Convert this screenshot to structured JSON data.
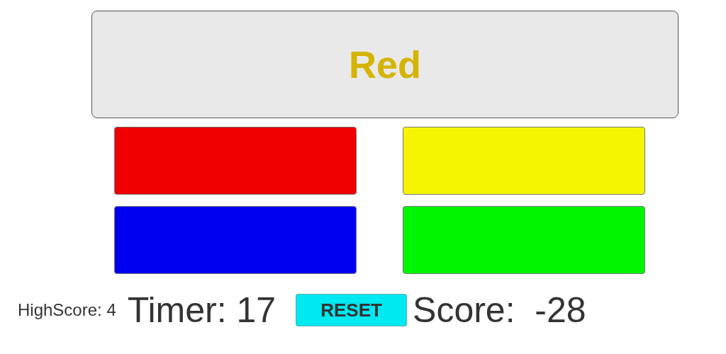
{
  "prompt": {
    "word": "Red",
    "color": "#d4b400"
  },
  "color_buttons": [
    {
      "color": "#f00000"
    },
    {
      "color": "#f5f500"
    },
    {
      "color": "#0000f0"
    },
    {
      "color": "#00f500"
    }
  ],
  "footer": {
    "high_score": "HighScore: 4",
    "timer": "Timer: 17",
    "reset_button": "RESET",
    "score": "Score:  -28"
  }
}
